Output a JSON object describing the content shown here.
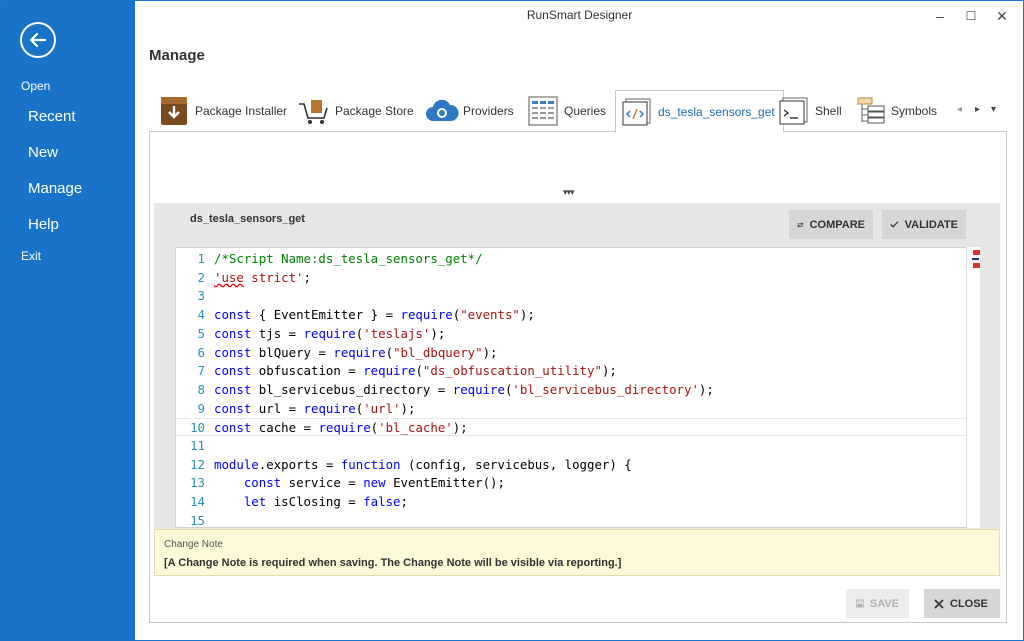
{
  "sidebar": {
    "back_icon": "arrow-left-icon",
    "open": "Open",
    "recent": "Recent",
    "new": "New",
    "manage": "Manage",
    "help": "Help",
    "exit": "Exit"
  },
  "window": {
    "title": "RunSmart Designer",
    "minimize": "–",
    "maximize": "☐",
    "close": "✕"
  },
  "page": {
    "title": "Manage"
  },
  "tabs": [
    {
      "label": "Package Installer",
      "icon": "package-installer-icon"
    },
    {
      "label": "Package Store",
      "icon": "shopping-cart-icon"
    },
    {
      "label": "Providers",
      "icon": "cloud-gear-icon"
    },
    {
      "label": "Queries",
      "icon": "table-query-icon"
    },
    {
      "label": "ds_tesla_sensors_get",
      "icon": "code-file-icon",
      "active": true
    },
    {
      "label": "Shell",
      "icon": "terminal-icon"
    },
    {
      "label": "Symbols",
      "icon": "symbols-tree-icon"
    }
  ],
  "tab_nav": {
    "prev": "◂",
    "next": "▸",
    "menu": "▾"
  },
  "expander": "▾▾▾",
  "editor": {
    "script_name": "ds_tesla_sensors_get",
    "compare_label": "COMPARE",
    "validate_label": "VALIDATE",
    "lines": [
      {
        "n": "1",
        "parts": [
          [
            "c-com",
            "/*Script Name:ds_tesla_sensors_get*/"
          ]
        ]
      },
      {
        "n": "2",
        "parts": [
          [
            "c-str squiggle",
            "'use"
          ],
          [
            "c-str",
            " strict'"
          ],
          [
            "c-txt",
            ";"
          ]
        ]
      },
      {
        "n": "3",
        "parts": []
      },
      {
        "n": "4",
        "parts": [
          [
            "c-kw",
            "const"
          ],
          [
            "c-txt",
            " { EventEmitter } = "
          ],
          [
            "c-kw",
            "require"
          ],
          [
            "c-txt",
            "("
          ],
          [
            "c-str",
            "\"events\""
          ],
          [
            "c-txt",
            ");"
          ]
        ]
      },
      {
        "n": "5",
        "parts": [
          [
            "c-kw",
            "const"
          ],
          [
            "c-txt",
            " tjs = "
          ],
          [
            "c-kw",
            "require"
          ],
          [
            "c-txt",
            "("
          ],
          [
            "c-str",
            "'teslajs'"
          ],
          [
            "c-txt",
            ");"
          ]
        ]
      },
      {
        "n": "6",
        "parts": [
          [
            "c-kw",
            "const"
          ],
          [
            "c-txt",
            " blQuery = "
          ],
          [
            "c-kw",
            "require"
          ],
          [
            "c-txt",
            "("
          ],
          [
            "c-str",
            "\"bl_dbquery\""
          ],
          [
            "c-txt",
            ");"
          ]
        ]
      },
      {
        "n": "7",
        "parts": [
          [
            "c-kw",
            "const"
          ],
          [
            "c-txt",
            " obfuscation = "
          ],
          [
            "c-kw",
            "require"
          ],
          [
            "c-txt",
            "("
          ],
          [
            "c-str",
            "\"ds_obfuscation_utility\""
          ],
          [
            "c-txt",
            ");"
          ]
        ]
      },
      {
        "n": "8",
        "parts": [
          [
            "c-kw",
            "const"
          ],
          [
            "c-txt",
            " bl_servicebus_directory = "
          ],
          [
            "c-kw",
            "require"
          ],
          [
            "c-txt",
            "("
          ],
          [
            "c-str",
            "'bl_servicebus_directory'"
          ],
          [
            "c-txt",
            ");"
          ]
        ]
      },
      {
        "n": "9",
        "parts": [
          [
            "c-kw",
            "const"
          ],
          [
            "c-txt",
            " url = "
          ],
          [
            "c-kw",
            "require"
          ],
          [
            "c-txt",
            "("
          ],
          [
            "c-str",
            "'url'"
          ],
          [
            "c-txt",
            ");"
          ]
        ]
      },
      {
        "n": "10",
        "parts": [
          [
            "c-kw",
            "const"
          ],
          [
            "c-txt",
            " cache = "
          ],
          [
            "c-kw",
            "require"
          ],
          [
            "c-txt",
            "("
          ],
          [
            "c-str",
            "'bl_cache'"
          ],
          [
            "c-txt",
            ");"
          ]
        ],
        "current": true
      },
      {
        "n": "11",
        "parts": []
      },
      {
        "n": "12",
        "parts": [
          [
            "c-kw",
            "module"
          ],
          [
            "c-txt",
            ".exports = "
          ],
          [
            "c-kw",
            "function"
          ],
          [
            "c-txt",
            " (config, servicebus, logger) {"
          ]
        ]
      },
      {
        "n": "13",
        "parts": [
          [
            "c-txt",
            "    "
          ],
          [
            "c-kw",
            "const"
          ],
          [
            "c-txt",
            " service = "
          ],
          [
            "c-kw",
            "new"
          ],
          [
            "c-txt",
            " EventEmitter();"
          ]
        ]
      },
      {
        "n": "14",
        "parts": [
          [
            "c-txt",
            "    "
          ],
          [
            "c-kw",
            "let"
          ],
          [
            "c-txt",
            " isClosing = "
          ],
          [
            "c-kw",
            "false"
          ],
          [
            "c-txt",
            ";"
          ]
        ]
      },
      {
        "n": "15",
        "parts": []
      }
    ]
  },
  "change_note": {
    "label": "Change Note",
    "text": "[A Change Note is required when saving. The Change Note will be visible via reporting.]"
  },
  "footer": {
    "save_label": "SAVE",
    "close_label": "CLOSE"
  },
  "colors": {
    "sidebar": "#1873c9",
    "accent": "#1a6cb7",
    "comment": "#008000",
    "string": "#a31515",
    "keyword": "#0000ff"
  }
}
